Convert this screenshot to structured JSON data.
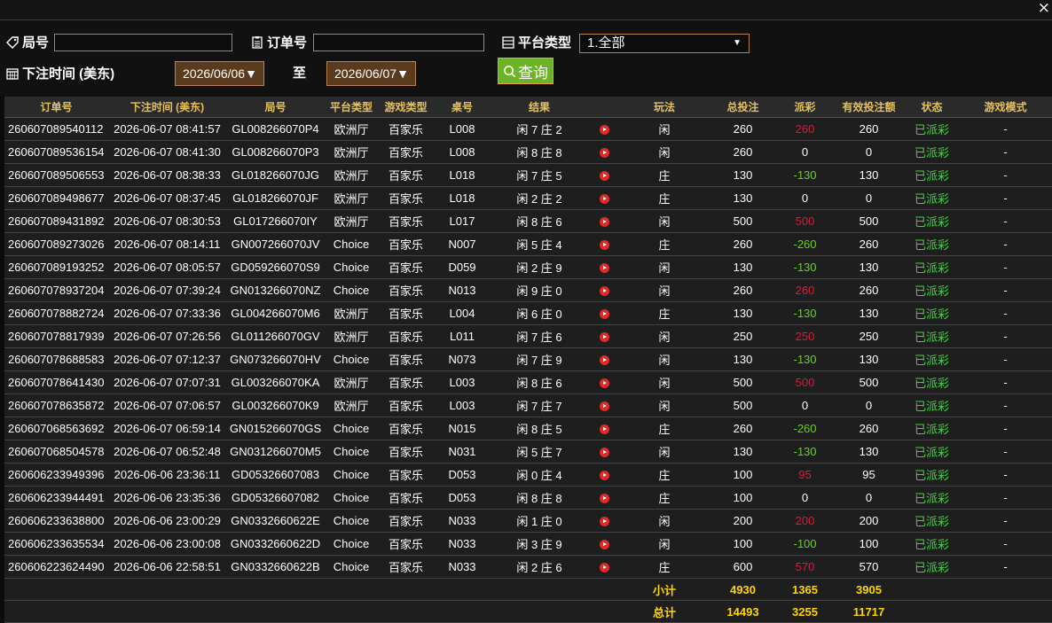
{
  "window": {
    "close": "×"
  },
  "filters": {
    "round_label": "局号",
    "order_label": "订单号",
    "platform_label": "平台类型",
    "platform_value": "1.全部",
    "time_label": "下注时间 (美东)",
    "date_from": "2026/06/06",
    "to_label": "至",
    "date_to": "2026/06/07",
    "query_label": "查询"
  },
  "columns": [
    "订单号",
    "下注时间 (美东)",
    "局号",
    "平台类型",
    "游戏类型",
    "桌号",
    "结果",
    "",
    "玩法",
    "总投注",
    "派彩",
    "有效投注额",
    "状态",
    "游戏模式"
  ],
  "rows": [
    {
      "order": "260607089540112",
      "time": "2026-06-07 08:41:57",
      "round": "GL008266070P4",
      "platform": "欧洲厅",
      "game": "百家乐",
      "table": "L008",
      "result": "闲 7 庄 2",
      "play": "闲",
      "bet": "260",
      "payout": "260",
      "payout_color": "red",
      "valid": "260",
      "status": "已派彩",
      "mode": "-"
    },
    {
      "order": "260607089536154",
      "time": "2026-06-07 08:41:30",
      "round": "GL008266070P3",
      "platform": "欧洲厅",
      "game": "百家乐",
      "table": "L008",
      "result": "闲 8 庄 8",
      "play": "闲",
      "bet": "260",
      "payout": "0",
      "payout_color": "white",
      "valid": "0",
      "status": "已派彩",
      "mode": "-"
    },
    {
      "order": "260607089506553",
      "time": "2026-06-07 08:38:33",
      "round": "GL018266070JG",
      "platform": "欧洲厅",
      "game": "百家乐",
      "table": "L018",
      "result": "闲 7 庄 5",
      "play": "庄",
      "bet": "130",
      "payout": "-130",
      "payout_color": "green",
      "valid": "130",
      "status": "已派彩",
      "mode": "-"
    },
    {
      "order": "260607089498677",
      "time": "2026-06-07 08:37:45",
      "round": "GL018266070JF",
      "platform": "欧洲厅",
      "game": "百家乐",
      "table": "L018",
      "result": "闲 2 庄 2",
      "play": "庄",
      "bet": "130",
      "payout": "0",
      "payout_color": "white",
      "valid": "0",
      "status": "已派彩",
      "mode": "-"
    },
    {
      "order": "260607089431892",
      "time": "2026-06-07 08:30:53",
      "round": "GL017266070IY",
      "platform": "欧洲厅",
      "game": "百家乐",
      "table": "L017",
      "result": "闲 8 庄 6",
      "play": "闲",
      "bet": "500",
      "payout": "500",
      "payout_color": "red",
      "valid": "500",
      "status": "已派彩",
      "mode": "-"
    },
    {
      "order": "260607089273026",
      "time": "2026-06-07 08:14:11",
      "round": "GN007266070JV",
      "platform": "Choice",
      "game": "百家乐",
      "table": "N007",
      "result": "闲 5 庄 4",
      "play": "庄",
      "bet": "260",
      "payout": "-260",
      "payout_color": "green",
      "valid": "260",
      "status": "已派彩",
      "mode": "-"
    },
    {
      "order": "260607089193252",
      "time": "2026-06-07 08:05:57",
      "round": "GD059266070S9",
      "platform": "Choice",
      "game": "百家乐",
      "table": "D059",
      "result": "闲 2 庄 9",
      "play": "闲",
      "bet": "130",
      "payout": "-130",
      "payout_color": "green",
      "valid": "130",
      "status": "已派彩",
      "mode": "-"
    },
    {
      "order": "260607078937204",
      "time": "2026-06-07 07:39:24",
      "round": "GN013266070NZ",
      "platform": "Choice",
      "game": "百家乐",
      "table": "N013",
      "result": "闲 9 庄 0",
      "play": "闲",
      "bet": "260",
      "payout": "260",
      "payout_color": "red",
      "valid": "260",
      "status": "已派彩",
      "mode": "-"
    },
    {
      "order": "260607078882724",
      "time": "2026-06-07 07:33:36",
      "round": "GL004266070M6",
      "platform": "欧洲厅",
      "game": "百家乐",
      "table": "L004",
      "result": "闲 6 庄 0",
      "play": "庄",
      "bet": "130",
      "payout": "-130",
      "payout_color": "green",
      "valid": "130",
      "status": "已派彩",
      "mode": "-"
    },
    {
      "order": "260607078817939",
      "time": "2026-06-07 07:26:56",
      "round": "GL011266070GV",
      "platform": "欧洲厅",
      "game": "百家乐",
      "table": "L011",
      "result": "闲 7 庄 6",
      "play": "闲",
      "bet": "250",
      "payout": "250",
      "payout_color": "red",
      "valid": "250",
      "status": "已派彩",
      "mode": "-"
    },
    {
      "order": "260607078688583",
      "time": "2026-06-07 07:12:37",
      "round": "GN073266070HV",
      "platform": "Choice",
      "game": "百家乐",
      "table": "N073",
      "result": "闲 7 庄 9",
      "play": "闲",
      "bet": "130",
      "payout": "-130",
      "payout_color": "green",
      "valid": "130",
      "status": "已派彩",
      "mode": "-"
    },
    {
      "order": "260607078641430",
      "time": "2026-06-07 07:07:31",
      "round": "GL003266070KA",
      "platform": "欧洲厅",
      "game": "百家乐",
      "table": "L003",
      "result": "闲 8 庄 6",
      "play": "闲",
      "bet": "500",
      "payout": "500",
      "payout_color": "red",
      "valid": "500",
      "status": "已派彩",
      "mode": "-"
    },
    {
      "order": "260607078635872",
      "time": "2026-06-07 07:06:57",
      "round": "GL003266070K9",
      "platform": "欧洲厅",
      "game": "百家乐",
      "table": "L003",
      "result": "闲 7 庄 7",
      "play": "闲",
      "bet": "500",
      "payout": "0",
      "payout_color": "white",
      "valid": "0",
      "status": "已派彩",
      "mode": "-"
    },
    {
      "order": "260607068563692",
      "time": "2026-06-07 06:59:14",
      "round": "GN015266070GS",
      "platform": "Choice",
      "game": "百家乐",
      "table": "N015",
      "result": "闲 8 庄 5",
      "play": "庄",
      "bet": "260",
      "payout": "-260",
      "payout_color": "green",
      "valid": "260",
      "status": "已派彩",
      "mode": "-"
    },
    {
      "order": "260607068504578",
      "time": "2026-06-07 06:52:48",
      "round": "GN031266070M5",
      "platform": "Choice",
      "game": "百家乐",
      "table": "N031",
      "result": "闲 5 庄 7",
      "play": "闲",
      "bet": "130",
      "payout": "-130",
      "payout_color": "green",
      "valid": "130",
      "status": "已派彩",
      "mode": "-"
    },
    {
      "order": "260606233949396",
      "time": "2026-06-06 23:36:11",
      "round": "GD05326607083",
      "platform": "Choice",
      "game": "百家乐",
      "table": "D053",
      "result": "闲 0 庄 4",
      "play": "庄",
      "bet": "100",
      "payout": "95",
      "payout_color": "red",
      "valid": "95",
      "status": "已派彩",
      "mode": "-"
    },
    {
      "order": "260606233944491",
      "time": "2026-06-06 23:35:36",
      "round": "GD05326607082",
      "platform": "Choice",
      "game": "百家乐",
      "table": "D053",
      "result": "闲 8 庄 8",
      "play": "庄",
      "bet": "100",
      "payout": "0",
      "payout_color": "white",
      "valid": "0",
      "status": "已派彩",
      "mode": "-"
    },
    {
      "order": "260606233638800",
      "time": "2026-06-06 23:00:29",
      "round": "GN0332660622E",
      "platform": "Choice",
      "game": "百家乐",
      "table": "N033",
      "result": "闲 1 庄 0",
      "play": "闲",
      "bet": "200",
      "payout": "200",
      "payout_color": "red",
      "valid": "200",
      "status": "已派彩",
      "mode": "-"
    },
    {
      "order": "260606233635534",
      "time": "2026-06-06 23:00:08",
      "round": "GN0332660622D",
      "platform": "Choice",
      "game": "百家乐",
      "table": "N033",
      "result": "闲 3 庄 9",
      "play": "闲",
      "bet": "100",
      "payout": "-100",
      "payout_color": "green",
      "valid": "100",
      "status": "已派彩",
      "mode": "-"
    },
    {
      "order": "260606223624490",
      "time": "2026-06-06 22:58:51",
      "round": "GN0332660622B",
      "platform": "Choice",
      "game": "百家乐",
      "table": "N033",
      "result": "闲 2 庄 6",
      "play": "庄",
      "bet": "600",
      "payout": "570",
      "payout_color": "red",
      "valid": "570",
      "status": "已派彩",
      "mode": "-"
    }
  ],
  "subtotal": {
    "label": "小计",
    "bet": "4930",
    "payout": "1365",
    "valid": "3905"
  },
  "total": {
    "label": "总计",
    "bet": "14493",
    "payout": "3255",
    "valid": "11717"
  },
  "colors": {
    "header_text": "#e5c15f",
    "accent_border": "#b5834c",
    "query_button": "#6cb425",
    "payout_win": "#e0183a",
    "payout_loss": "#67d41a",
    "status": "#3fd63f",
    "totals": "#ffd500"
  }
}
